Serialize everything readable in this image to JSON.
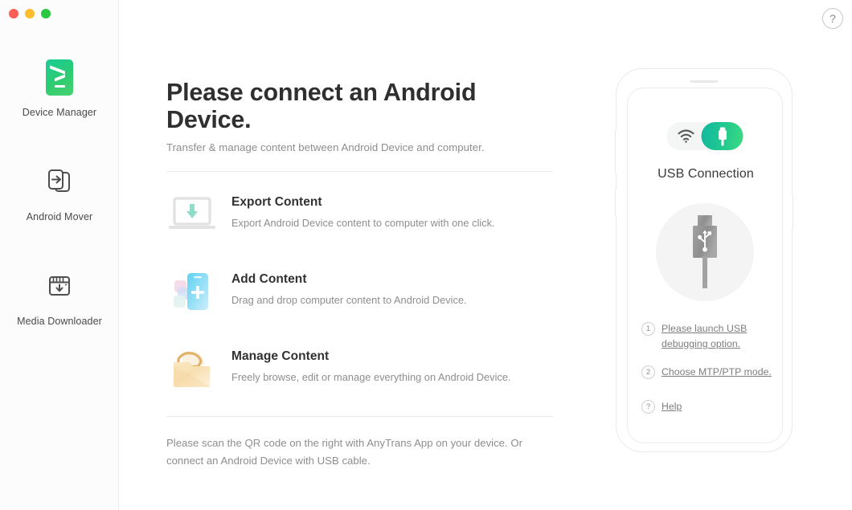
{
  "window": {
    "traffic_lights": [
      {
        "name": "close",
        "color": "#ff5f57"
      },
      {
        "name": "minimize",
        "color": "#ffbd2e"
      },
      {
        "name": "zoom",
        "color": "#28c840"
      }
    ],
    "help_label": "?"
  },
  "sidebar": {
    "items": [
      {
        "label": "Device Manager",
        "icon": "device-manager-icon",
        "active": true
      },
      {
        "label": "Android Mover",
        "icon": "android-mover-icon",
        "active": false
      },
      {
        "label": "Media Downloader",
        "icon": "media-downloader-icon",
        "active": false
      }
    ]
  },
  "main": {
    "title": "Please connect an Android Device.",
    "subtitle": "Transfer & manage content between Android Device and computer.",
    "features": [
      {
        "icon": "export-content-icon",
        "title": "Export Content",
        "desc": "Export Android Device content to computer with one click."
      },
      {
        "icon": "add-content-icon",
        "title": "Add Content",
        "desc": "Drag and drop computer content to Android Device."
      },
      {
        "icon": "manage-content-icon",
        "title": "Manage Content",
        "desc": "Freely browse, edit or manage everything on Android Device."
      }
    ],
    "footnote": "Please scan the QR code on the right with AnyTrans App on your device. Or connect an Android Device with USB cable."
  },
  "phone": {
    "toggle": {
      "wifi_icon": "wifi-icon",
      "usb_icon": "usb-plug-icon",
      "selected": "usb",
      "active_color": "#23c98e"
    },
    "connection_label": "USB Connection",
    "usb_illustration_icon": "usb-connector-icon",
    "steps": [
      {
        "num": "1",
        "text": "Please launch USB debugging option."
      },
      {
        "num": "2",
        "text": "Choose MTP/PTP mode."
      }
    ],
    "help_step": {
      "num": "?",
      "text": "Help"
    }
  }
}
